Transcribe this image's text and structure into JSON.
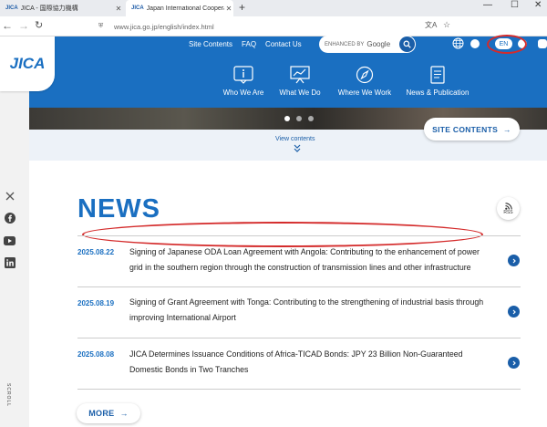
{
  "browser": {
    "tabs": [
      {
        "favicon": "JICA",
        "title": "JICA - 国際協力機構",
        "active": false
      },
      {
        "favicon": "JICA",
        "title": "Japan International Cooperatio",
        "active": true
      }
    ],
    "url": "www.jica.go.jp/english/index.html"
  },
  "header": {
    "logo": "JICA",
    "toplinks": [
      "Site Contents",
      "FAQ",
      "Contact Us"
    ],
    "search": {
      "prefix": "ENHANCED BY",
      "brand": "Google"
    },
    "language": {
      "current": "EN"
    },
    "nav": [
      {
        "label": "Who We Are",
        "icon": "info-icon"
      },
      {
        "label": "What We Do",
        "icon": "presentation-icon"
      },
      {
        "label": "Where We Work",
        "icon": "compass-icon"
      },
      {
        "label": "News & Publication",
        "icon": "document-icon"
      }
    ]
  },
  "hero": {
    "view_contents": "View contents",
    "site_contents_button": "SITE CONTENTS",
    "slides": 3,
    "active_slide": 0
  },
  "rail": {
    "social": [
      "x-icon",
      "facebook-icon",
      "youtube-icon",
      "linkedin-icon"
    ],
    "scroll_label": "SCROLL"
  },
  "news": {
    "title": "NEWS",
    "rss_label": "RSS",
    "items": [
      {
        "date": "2025.08.22",
        "text": "Signing of Japanese ODA Loan Agreement with Angola: Contributing to the enhancement of power grid in the southern region through the construction of transmission lines and other infrastructure"
      },
      {
        "date": "2025.08.19",
        "text": "Signing of Grant Agreement with Tonga: Contributing to the strengthening of industrial basis through improving International Airport"
      },
      {
        "date": "2025.08.08",
        "text": "JICA Determines Issuance Conditions of Africa-TICAD Bonds: JPY 23 Billion Non-Guaranteed Domestic Bonds in Two Tranches"
      }
    ],
    "more_label": "MORE"
  },
  "colors": {
    "brand_blue": "#1a6fc1",
    "annotation_red": "#d42b2b"
  }
}
